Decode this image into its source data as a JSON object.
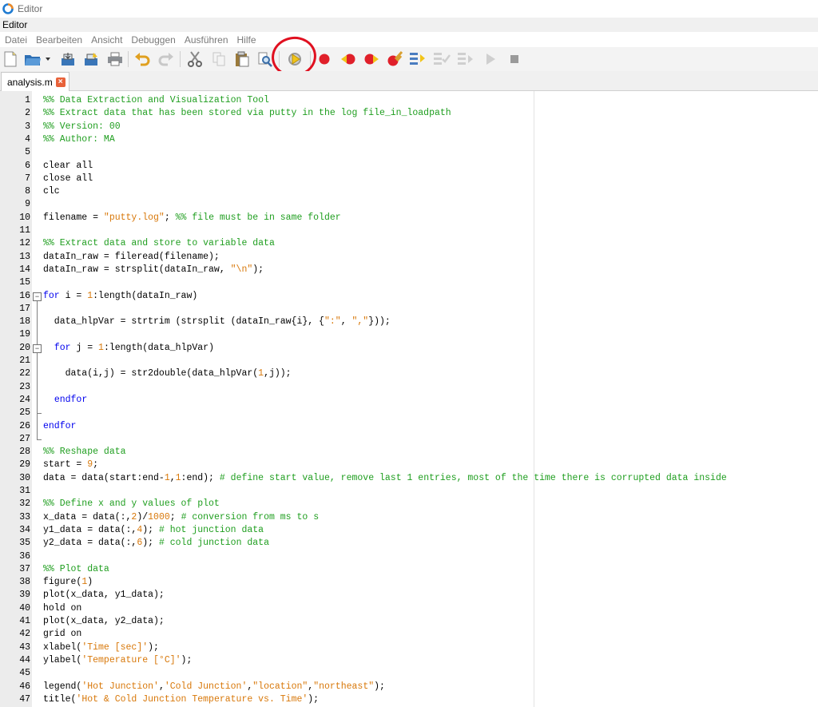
{
  "window": {
    "title": "Editor"
  },
  "panel": {
    "title": "Editor"
  },
  "menu": [
    "Datei",
    "Bearbeiten",
    "Ansicht",
    "Debuggen",
    "Ausführen",
    "Hilfe"
  ],
  "toolbar": {
    "icons": [
      "new-file-icon",
      "open-file-icon",
      "dropdown-arrow-icon",
      "save-icon",
      "save-as-icon",
      "print-icon",
      "undo-icon",
      "redo-icon",
      "cut-icon",
      "copy-icon",
      "paste-icon",
      "find-icon",
      "save-and-run-icon",
      "breakpoint-icon",
      "previous-breakpoint-icon",
      "next-breakpoint-icon",
      "clear-breakpoints-icon",
      "step-icon",
      "step-in-icon",
      "step-out-icon",
      "continue-icon",
      "stop-icon"
    ],
    "annotation_color": "#e01020"
  },
  "tabs": [
    {
      "label": "analysis.m",
      "close": "×"
    }
  ],
  "colors": {
    "comment": "#1f9e1f",
    "keyword": "#0000ee",
    "string": "#d8780a"
  },
  "code_lines": [
    {
      "n": "1",
      "segs": [
        [
          "com",
          "%% Data Extraction and Visualization Tool"
        ]
      ]
    },
    {
      "n": "2",
      "segs": [
        [
          "com",
          "%% Extract data that has been stored via putty in the log file_in_loadpath"
        ]
      ]
    },
    {
      "n": "3",
      "segs": [
        [
          "com",
          "%% Version: 00"
        ]
      ]
    },
    {
      "n": "4",
      "segs": [
        [
          "com",
          "%% Author: MA"
        ]
      ]
    },
    {
      "n": "5",
      "segs": []
    },
    {
      "n": "6",
      "segs": [
        [
          "txt",
          "clear all"
        ]
      ]
    },
    {
      "n": "7",
      "segs": [
        [
          "txt",
          "close all"
        ]
      ]
    },
    {
      "n": "8",
      "segs": [
        [
          "txt",
          "clc"
        ]
      ]
    },
    {
      "n": "9",
      "segs": []
    },
    {
      "n": "10",
      "segs": [
        [
          "txt",
          "filename = "
        ],
        [
          "str",
          "\"putty.log\""
        ],
        [
          "txt",
          "; "
        ],
        [
          "com",
          "%% file must be in same folder"
        ]
      ]
    },
    {
      "n": "11",
      "segs": []
    },
    {
      "n": "12",
      "segs": [
        [
          "com",
          "%% Extract data and store to variable data"
        ]
      ]
    },
    {
      "n": "13",
      "segs": [
        [
          "txt",
          "dataIn_raw = fileread(filename);"
        ]
      ]
    },
    {
      "n": "14",
      "segs": [
        [
          "txt",
          "dataIn_raw = strsplit(dataIn_raw, "
        ],
        [
          "str",
          "\"\\n\""
        ],
        [
          "txt",
          ");"
        ]
      ]
    },
    {
      "n": "15",
      "segs": []
    },
    {
      "n": "16",
      "segs": [
        [
          "kw",
          "for"
        ],
        [
          "txt",
          " i = "
        ],
        [
          "num",
          "1"
        ],
        [
          "txt",
          ":length(dataIn_raw)"
        ]
      ]
    },
    {
      "n": "17",
      "segs": []
    },
    {
      "n": "18",
      "segs": [
        [
          "txt",
          "  data_hlpVar = strtrim (strsplit (dataIn_raw{i}, {"
        ],
        [
          "str",
          "\":\""
        ],
        [
          "txt",
          ", "
        ],
        [
          "str",
          "\",\""
        ],
        [
          "txt",
          "}));"
        ]
      ]
    },
    {
      "n": "19",
      "segs": []
    },
    {
      "n": "20",
      "segs": [
        [
          "txt",
          "  "
        ],
        [
          "kw",
          "for"
        ],
        [
          "txt",
          " j = "
        ],
        [
          "num",
          "1"
        ],
        [
          "txt",
          ":length(data_hlpVar)"
        ]
      ]
    },
    {
      "n": "21",
      "segs": []
    },
    {
      "n": "22",
      "segs": [
        [
          "txt",
          "    data(i,j) = str2double(data_hlpVar("
        ],
        [
          "num",
          "1"
        ],
        [
          "txt",
          ",j));"
        ]
      ]
    },
    {
      "n": "23",
      "segs": []
    },
    {
      "n": "24",
      "segs": [
        [
          "txt",
          "  "
        ],
        [
          "kw",
          "endfor"
        ]
      ]
    },
    {
      "n": "25",
      "segs": []
    },
    {
      "n": "26",
      "segs": [
        [
          "kw",
          "endfor"
        ]
      ]
    },
    {
      "n": "27",
      "segs": []
    },
    {
      "n": "28",
      "segs": [
        [
          "com",
          "%% Reshape data"
        ]
      ]
    },
    {
      "n": "29",
      "segs": [
        [
          "txt",
          "start = "
        ],
        [
          "num",
          "9"
        ],
        [
          "txt",
          ";"
        ]
      ]
    },
    {
      "n": "30",
      "segs": [
        [
          "txt",
          "data = data(start:end-"
        ],
        [
          "num",
          "1"
        ],
        [
          "txt",
          ","
        ],
        [
          "num",
          "1"
        ],
        [
          "txt",
          ":end); "
        ],
        [
          "com",
          "# define start value, remove last 1 entries, most of the time there is corrupted data inside"
        ]
      ]
    },
    {
      "n": "31",
      "segs": []
    },
    {
      "n": "32",
      "segs": [
        [
          "com",
          "%% Define x and y values of plot"
        ]
      ]
    },
    {
      "n": "33",
      "segs": [
        [
          "txt",
          "x_data = data(:,"
        ],
        [
          "num",
          "2"
        ],
        [
          "txt",
          ")/"
        ],
        [
          "num",
          "1000"
        ],
        [
          "txt",
          "; "
        ],
        [
          "com",
          "# conversion from ms to s"
        ]
      ]
    },
    {
      "n": "34",
      "segs": [
        [
          "txt",
          "y1_data = data(:,"
        ],
        [
          "num",
          "4"
        ],
        [
          "txt",
          "); "
        ],
        [
          "com",
          "# hot junction data"
        ]
      ]
    },
    {
      "n": "35",
      "segs": [
        [
          "txt",
          "y2_data = data(:,"
        ],
        [
          "num",
          "6"
        ],
        [
          "txt",
          "); "
        ],
        [
          "com",
          "# cold junction data"
        ]
      ]
    },
    {
      "n": "36",
      "segs": []
    },
    {
      "n": "37",
      "segs": [
        [
          "com",
          "%% Plot data"
        ]
      ]
    },
    {
      "n": "38",
      "segs": [
        [
          "txt",
          "figure("
        ],
        [
          "num",
          "1"
        ],
        [
          "txt",
          ")"
        ]
      ]
    },
    {
      "n": "39",
      "segs": [
        [
          "txt",
          "plot(x_data, y1_data);"
        ]
      ]
    },
    {
      "n": "40",
      "segs": [
        [
          "txt",
          "hold on"
        ]
      ]
    },
    {
      "n": "41",
      "segs": [
        [
          "txt",
          "plot(x_data, y2_data);"
        ]
      ]
    },
    {
      "n": "42",
      "segs": [
        [
          "txt",
          "grid on"
        ]
      ]
    },
    {
      "n": "43",
      "segs": [
        [
          "txt",
          "xlabel("
        ],
        [
          "str",
          "'Time [sec]'"
        ],
        [
          "txt",
          ");"
        ]
      ]
    },
    {
      "n": "44",
      "segs": [
        [
          "txt",
          "ylabel("
        ],
        [
          "str",
          "'Temperature [°C]'"
        ],
        [
          "txt",
          ");"
        ]
      ]
    },
    {
      "n": "45",
      "segs": []
    },
    {
      "n": "46",
      "segs": [
        [
          "txt",
          "legend("
        ],
        [
          "str",
          "'Hot Junction'"
        ],
        [
          "txt",
          ","
        ],
        [
          "str",
          "'Cold Junction'"
        ],
        [
          "txt",
          ","
        ],
        [
          "str",
          "\"location\""
        ],
        [
          "txt",
          ","
        ],
        [
          "str",
          "\"northeast\""
        ],
        [
          "txt",
          ");"
        ]
      ]
    },
    {
      "n": "47",
      "segs": [
        [
          "txt",
          "title("
        ],
        [
          "str",
          "'Hot & Cold Junction Temperature vs. Time'"
        ],
        [
          "txt",
          ");"
        ]
      ]
    }
  ]
}
